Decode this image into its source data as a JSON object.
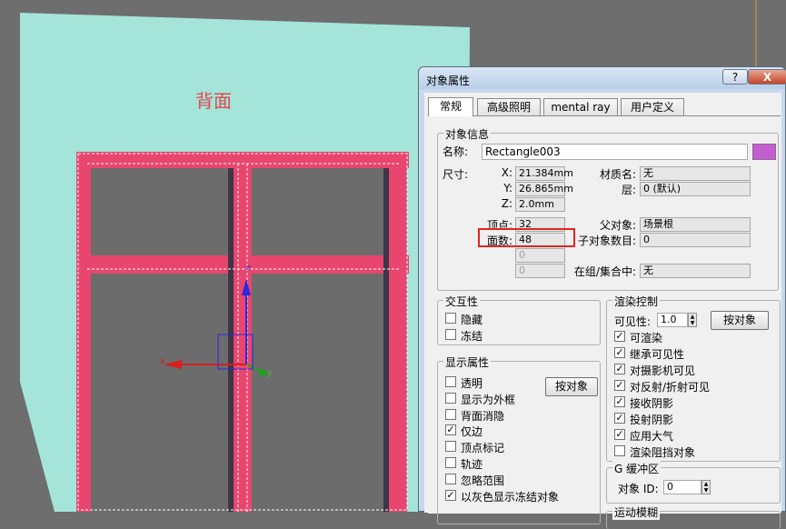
{
  "viewport": {
    "back_label": "背面",
    "colors": {
      "background": "#6e6e6e",
      "back_plane": "#a5e4d9",
      "frame": "#e8466e",
      "glass": "#6c6c6c"
    },
    "gizmo": {
      "x_label": "x",
      "y_label": "y",
      "z_label": "z"
    }
  },
  "dialog": {
    "title": "对象属性",
    "help_label": "?",
    "close_label": "X",
    "tabs": [
      {
        "label": "常规"
      },
      {
        "label": "高级照明"
      },
      {
        "label": "mental ray"
      },
      {
        "label": "用户定义"
      }
    ],
    "object_info": {
      "label": "对象信息",
      "name_label": "名称:",
      "name_value": "Rectangle003",
      "color_swatch": "#c35ed0",
      "size_label": "尺寸:",
      "x_label": "X:",
      "x_value": "21.384mm",
      "y_label": "Y:",
      "y_value": "26.865mm",
      "z_label": "Z:",
      "z_value": "2.0mm",
      "material_label": "材质名:",
      "material_value": "无",
      "layer_label": "层:",
      "layer_value": "0 (默认)",
      "vertices_label": "顶点:",
      "vertices_value": "32",
      "faces_label": "面数:",
      "faces_value": "48",
      "blank1_value": "0",
      "blank2_value": "0",
      "parent_label": "父对象:",
      "parent_value": "场景根",
      "children_label": "子对象数目:",
      "children_value": "0",
      "group_label": "在组/集合中:",
      "group_value": "无",
      "highlight_color": "#e0261f"
    },
    "interactivity": {
      "label": "交互性",
      "hide_label": "隐藏",
      "hide_checked": false,
      "freeze_label": "冻结",
      "freeze_checked": false
    },
    "display_props": {
      "label": "显示属性",
      "by_object_label": "按对象",
      "items": [
        {
          "label": "透明",
          "checked": false
        },
        {
          "label": "显示为外框",
          "checked": false
        },
        {
          "label": "背面消隐",
          "checked": false
        },
        {
          "label": "仅边",
          "checked": true
        },
        {
          "label": "顶点标记",
          "checked": false
        },
        {
          "label": "轨迹",
          "checked": false
        },
        {
          "label": "忽略范围",
          "checked": false
        },
        {
          "label": "以灰色显示冻结对象",
          "checked": true
        }
      ]
    },
    "render_control": {
      "label": "渲染控制",
      "visibility_label": "可见性:",
      "visibility_value": "1.0",
      "by_object_label": "按对象",
      "items": [
        {
          "label": "可渲染",
          "checked": true
        },
        {
          "label": "继承可见性",
          "checked": true
        },
        {
          "label": "对摄影机可见",
          "checked": true
        },
        {
          "label": "对反射/折射可见",
          "checked": true
        },
        {
          "label": "接收阴影",
          "checked": true
        },
        {
          "label": "投射阴影",
          "checked": true
        },
        {
          "label": "应用大气",
          "checked": true
        },
        {
          "label": "渲染阻挡对象",
          "checked": false
        }
      ]
    },
    "g_buffer": {
      "label": "G 缓冲区",
      "object_id_label": "对象 ID:",
      "object_id_value": "0"
    },
    "motion_blur": {
      "label": "运动模糊"
    }
  }
}
